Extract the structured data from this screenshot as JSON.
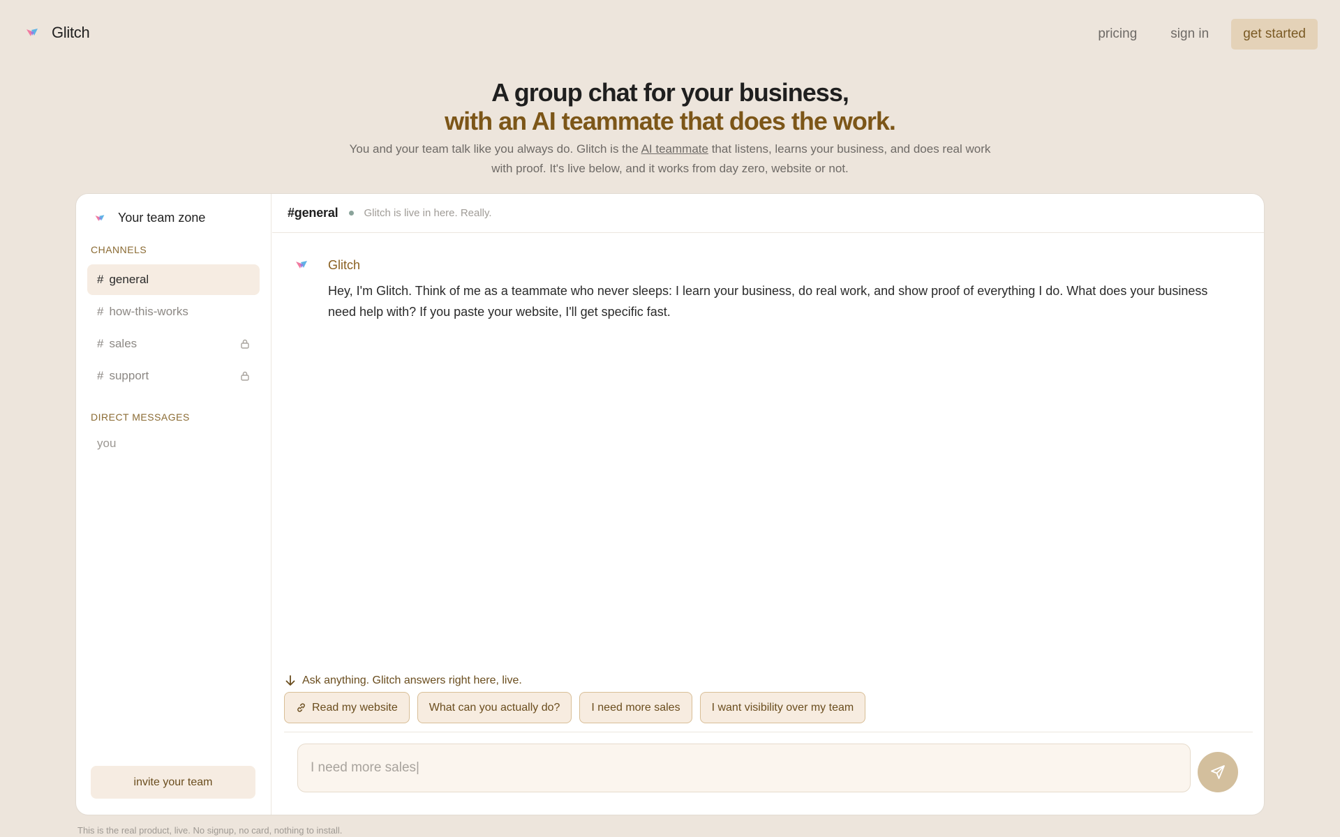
{
  "nav": {
    "brand": "Glitch",
    "links": [
      "pricing",
      "sign in"
    ],
    "cta": "get started"
  },
  "hero": {
    "title_line1": "A group chat for your business,",
    "title_line2": "with an AI teammate that does the work.",
    "sub_part1": "You and your team talk like you always do. Glitch is the ",
    "sub_link": "AI teammate",
    "sub_part2": " that listens, learns your business, and does real work with proof. It's live below, and it works from day zero, website or not."
  },
  "sidebar": {
    "team_name": "Your team zone",
    "channels_label": "CHANNELS",
    "channels": [
      {
        "hash": "#",
        "name": "general"
      },
      {
        "hash": "#",
        "name": "how-this-works"
      },
      {
        "hash": "#",
        "name": "sales"
      },
      {
        "hash": "#",
        "name": "support"
      }
    ],
    "dm_label": "DIRECT MESSAGES",
    "dm": "you",
    "invite": "invite your team"
  },
  "chat": {
    "channel": "#general",
    "status": "Glitch is live in here. Really.",
    "message": {
      "author": "Glitch",
      "text": "Hey, I'm Glitch. Think of me as a teammate who never sleeps: I learn your business, do real work, and show proof of everything I do. What does your business need help with? If you paste your website, I'll get specific fast."
    },
    "hint": "Ask anything. Glitch answers right here, live.",
    "chips": [
      "Read my website",
      "What can you actually do?",
      "I need more sales",
      "I want visibility over my team"
    ],
    "input_value": "I need more sales|"
  },
  "footnote": "This is the real product, live. No signup, no card, nothing to install.",
  "colors": {
    "background": "#ede5dc",
    "accent": "#7c5618",
    "cta_bg": "#e4d2b8",
    "send_bg": "#d3bf9d"
  }
}
